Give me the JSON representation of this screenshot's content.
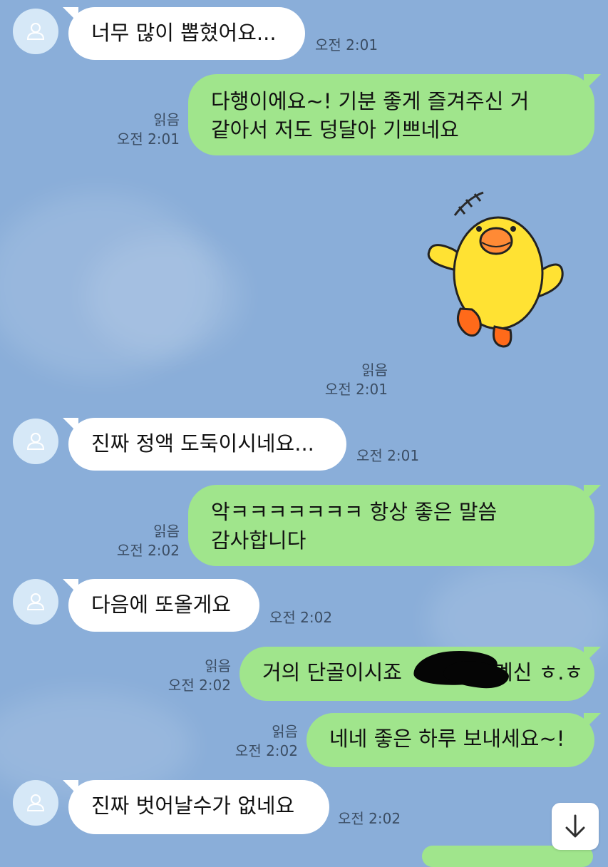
{
  "chat": {
    "colors": {
      "background": "#8aaed9",
      "received_bubble": "#ffffff",
      "sent_bubble": "#a0e58c",
      "meta_text": "#3b4d63"
    },
    "messages": [
      {
        "side": "received",
        "lines": [
          "너무 많이 뽑혔어요..."
        ],
        "time": "오전 2:01"
      },
      {
        "side": "sent",
        "lines": [
          "다행이에요~! 기분 좋게 즐겨주신 거",
          "같아서 저도 덩달아 기쁘네요"
        ],
        "read": "읽음",
        "time": "오전 2:01"
      },
      {
        "side": "sent",
        "type": "sticker",
        "sticker": "yellow-chick-sticker",
        "read": "읽음",
        "time": "오전 2:01"
      },
      {
        "side": "received",
        "lines": [
          "진짜 정액 도둑이시네요..."
        ],
        "time": "오전 2:01"
      },
      {
        "side": "sent",
        "lines": [
          "악ㅋㅋㅋㅋㅋㅋㅋ 항상 좋은 말씀",
          "감사합니다"
        ],
        "read": "읽음",
        "time": "오전 2:02"
      },
      {
        "side": "received",
        "lines": [
          "다음에 또올게요"
        ],
        "time": "오전 2:02"
      },
      {
        "side": "sent",
        "lines": [
          "거의 단골이시죠",
          "계신 ㅎ.ㅎ"
        ],
        "redacted": true,
        "read": "읽음",
        "time": "오전 2:02"
      },
      {
        "side": "sent",
        "lines": [
          "네네 좋은 하루 보내세요~!"
        ],
        "read": "읽음",
        "time": "오전 2:02"
      },
      {
        "side": "received",
        "lines": [
          "진짜 벗어날수가 없네요"
        ],
        "time": "오전 2:02"
      }
    ],
    "scroll_down_icon": "arrow-down-icon",
    "avatar_icon": "user-silhouette-icon"
  }
}
